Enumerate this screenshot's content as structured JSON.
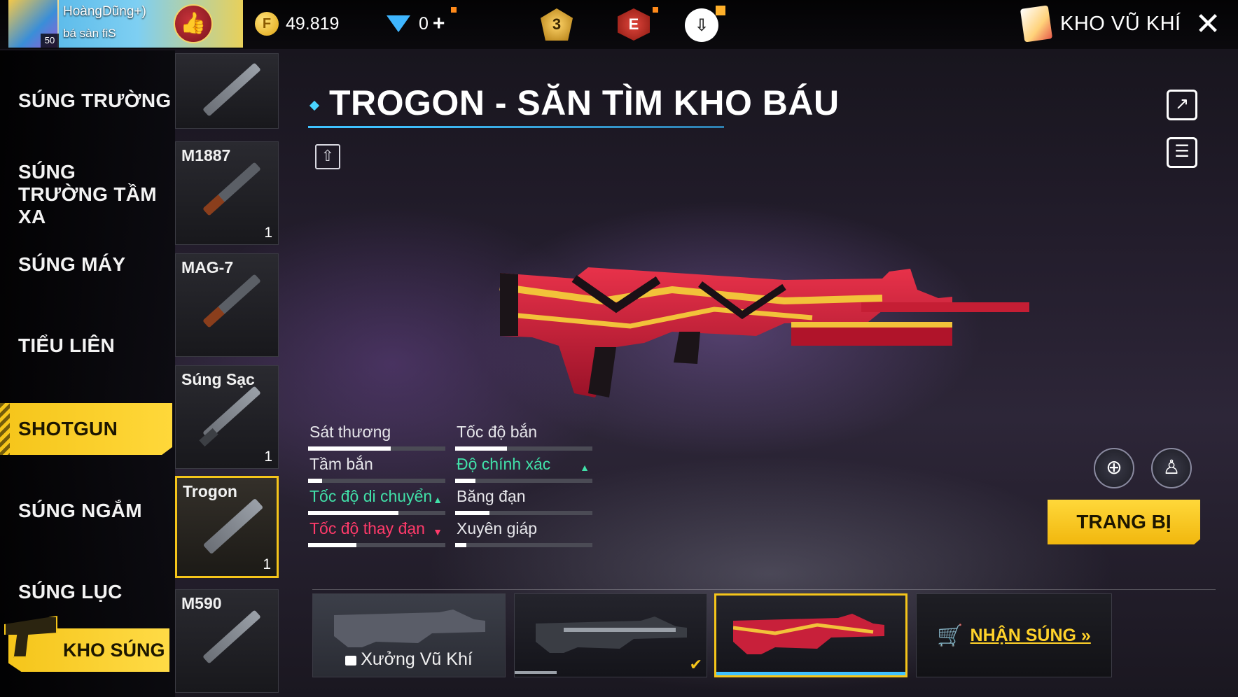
{
  "top": {
    "player_name": "HoàngDũng+)",
    "player_tag": "bá sàn fiS",
    "level": "50",
    "gold": "49.819",
    "diamonds": "0",
    "diamond_plus": "+",
    "rank_badge": "3",
    "elite_badge": "E",
    "armory_title": "KHO VŨ KHÍ"
  },
  "categories": [
    {
      "label": "SÚNG TRƯỜNG"
    },
    {
      "label": "SÚNG TRƯỜNG TẦM XA"
    },
    {
      "label": "SÚNG MÁY"
    },
    {
      "label": "TIỂU LIÊN"
    },
    {
      "label": "SHOTGUN",
      "active": true
    },
    {
      "label": "SÚNG NGẮM"
    },
    {
      "label": "SÚNG LỤC"
    }
  ],
  "kho_sung_label": "KHO SÚNG",
  "weapons": [
    {
      "name": "",
      "count": ""
    },
    {
      "name": "M1887",
      "count": "1"
    },
    {
      "name": "MAG-7",
      "count": ""
    },
    {
      "name": "Súng Sạc",
      "count": "1"
    },
    {
      "name": "Trogon",
      "count": "1",
      "selected": true
    },
    {
      "name": "M590",
      "count": ""
    }
  ],
  "title": "TROGON - SĂN TÌM KHO BÁU",
  "stats": [
    {
      "label": "Sát thương",
      "value": 0.6,
      "trend": "none"
    },
    {
      "label": "Tốc độ bắn",
      "value": 0.38,
      "trend": "none"
    },
    {
      "label": "Tầm bắn",
      "value": 0.1,
      "trend": "none"
    },
    {
      "label": "Độ chính xác",
      "value": 0.15,
      "trend": "up"
    },
    {
      "label": "Tốc độ di chuyển",
      "value": 0.66,
      "trend": "up"
    },
    {
      "label": "Băng đạn",
      "value": 0.25,
      "trend": "none"
    },
    {
      "label": "Tốc độ thay đạn",
      "value": 0.35,
      "trend": "down"
    },
    {
      "label": "Xuyên giáp",
      "value": 0.08,
      "trend": "none"
    }
  ],
  "equip_label": "TRANG BỊ",
  "skins": [
    {
      "label": "Xưởng Vũ Khí",
      "locked": true
    },
    {
      "label": "",
      "locked": false
    },
    {
      "label": "",
      "locked": false,
      "selected": true
    }
  ],
  "get_gun_label": "NHẬN SÚNG »",
  "colors": {
    "accent": "#f5c51a",
    "stat_up": "#41e0a8",
    "stat_down": "#ff3a6a",
    "title_line": "#3fc2ff"
  }
}
